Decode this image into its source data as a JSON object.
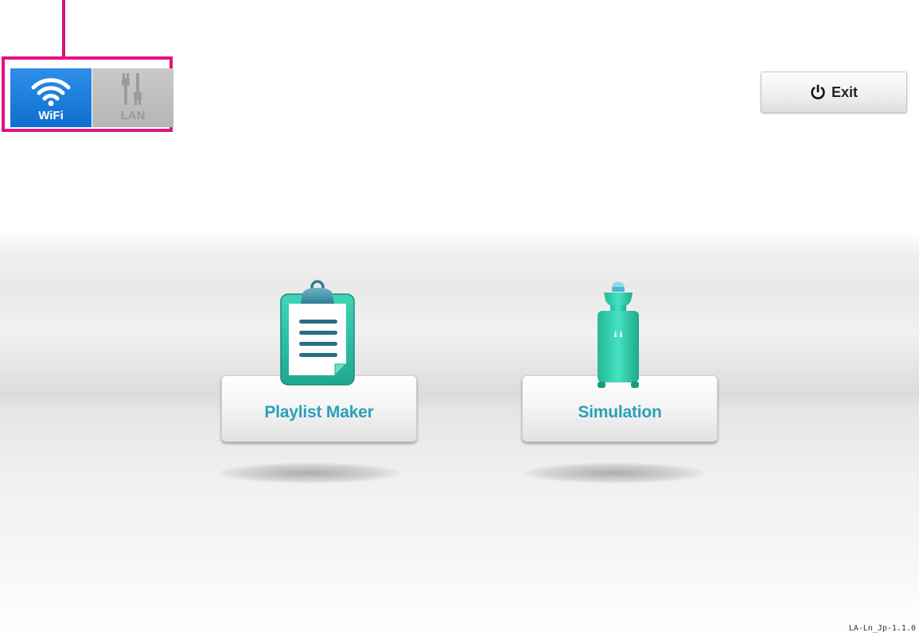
{
  "connection": {
    "wifi_label": "WiFi",
    "lan_label": "LAN",
    "wifi_icon": "wifi-icon",
    "lan_icon": "lan-cable-icon",
    "active": "WiFi",
    "highlight_color": "#e3137f"
  },
  "header": {
    "exit_label": "Exit",
    "exit_icon": "power-icon"
  },
  "apps": [
    {
      "label": "Playlist Maker",
      "icon": "clipboard-icon"
    },
    {
      "label": "Simulation",
      "icon": "manikin-icon"
    }
  ],
  "colors": {
    "accent": "#2aa1b8",
    "wifi_active": "#1a7fdc",
    "icon_teal": "#2fc9a6"
  },
  "footer": {
    "version": "LA-Ln_Jp-1.1.0"
  }
}
